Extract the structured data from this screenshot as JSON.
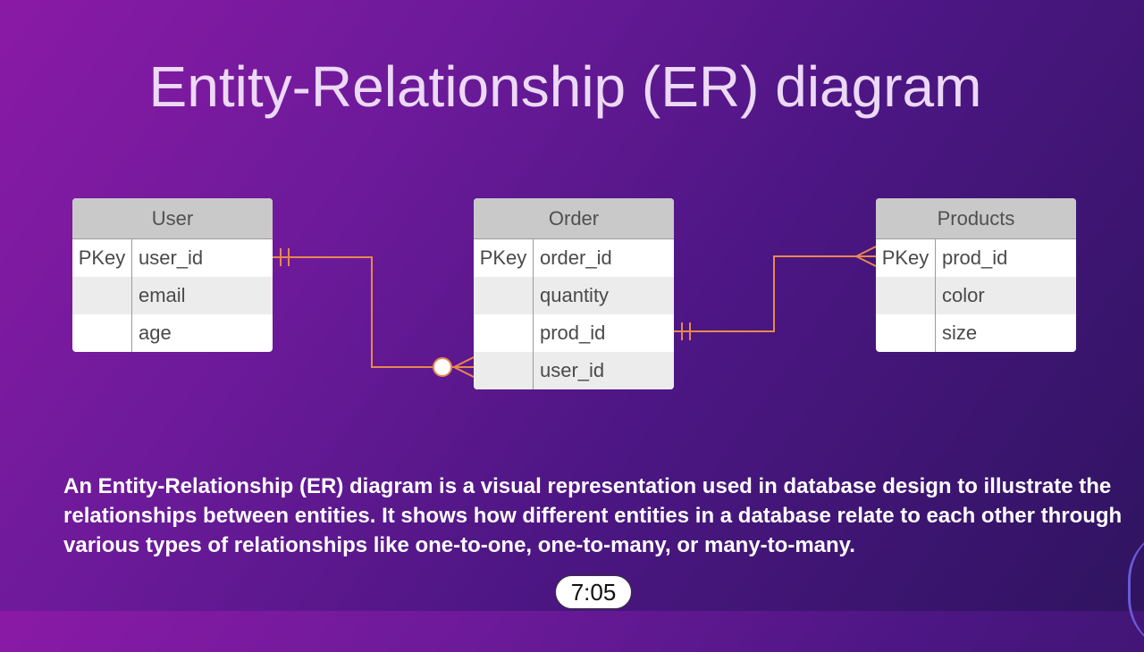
{
  "title": "Entity-Relationship (ER) diagram",
  "entities": [
    {
      "name": "User",
      "rows": [
        {
          "key": "PKey",
          "field": "user_id"
        },
        {
          "key": "",
          "field": "email"
        },
        {
          "key": "",
          "field": "age"
        }
      ]
    },
    {
      "name": "Order",
      "rows": [
        {
          "key": "PKey",
          "field": "order_id"
        },
        {
          "key": "",
          "field": "quantity"
        },
        {
          "key": "",
          "field": "prod_id"
        },
        {
          "key": "",
          "field": "user_id"
        }
      ]
    },
    {
      "name": "Products",
      "rows": [
        {
          "key": "PKey",
          "field": "prod_id"
        },
        {
          "key": "",
          "field": "color"
        },
        {
          "key": "",
          "field": "size"
        }
      ]
    }
  ],
  "colors": {
    "connector": "#e8884f",
    "header": "#c9c9c9"
  },
  "description": "An Entity-Relationship (ER) diagram is a visual representation used in database design to illustrate the relationships between entities. It shows how different entities in a database relate to each other through various types of relationships like one-to-one, one-to-many, or many-to-many.",
  "video": {
    "timestamp": "7:05"
  }
}
